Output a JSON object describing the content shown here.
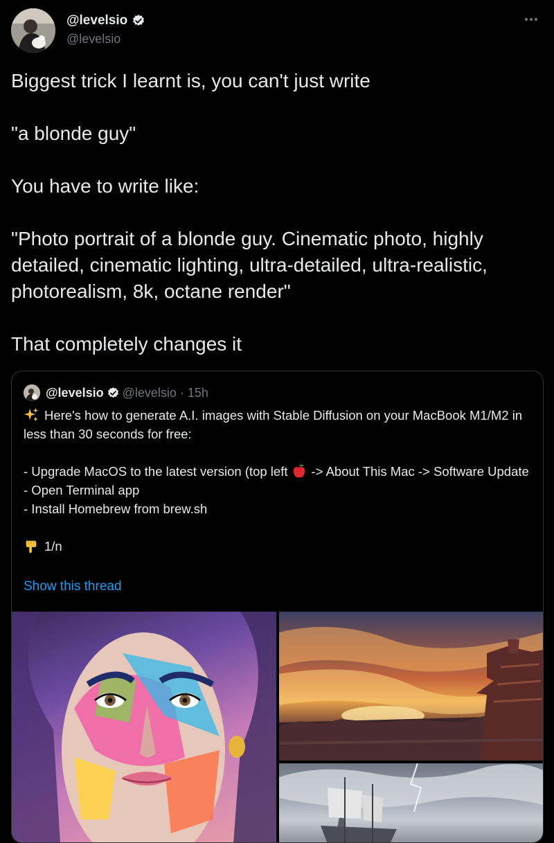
{
  "author": {
    "name": "@levelsio",
    "handle": "@levelsio"
  },
  "tweet": {
    "lines": [
      "Biggest trick I learnt is, you can't just write",
      "\"a blonde guy\"",
      "You have to write like:",
      "\"Photo portrait of a blonde guy. Cinematic photo, highly detailed, cinematic lighting, ultra-detailed, ultra-realistic, photorealism, 8k, octane render\"",
      "That completely changes it"
    ]
  },
  "quote": {
    "name": "@levelsio",
    "handle": "@levelsio",
    "separator": "·",
    "time": "15h",
    "line1": "Here's how to generate A.I. images with Stable Diffusion on your MacBook M1/M2 in less than 30 seconds for free:",
    "bullet1_pre": "- Upgrade MacOS to the latest version (top left",
    "bullet1_post": "-> About This Mac -> Software Update",
    "bullet2": "- Open Terminal app",
    "bullet3": "- Install Homebrew from brew.sh",
    "thread_count": "1/n",
    "show_thread": "Show this thread"
  },
  "colors": {
    "background": "#000000",
    "text": "#e7e9ea",
    "muted": "#71767b",
    "link": "#1d9bf0",
    "verified": "#e7e9ea"
  }
}
